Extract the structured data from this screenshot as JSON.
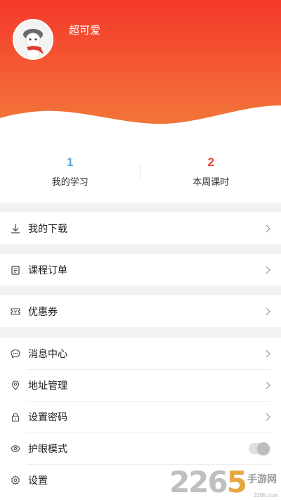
{
  "colors": {
    "accent": "#f24a2e",
    "stat_blue": "#5aa8d8",
    "stat_red": "#e84535"
  },
  "profile": {
    "username": "超可爱",
    "avatar_icon": "cartoon-avatar"
  },
  "stats": [
    {
      "value": "1",
      "label": "我的学习"
    },
    {
      "value": "2",
      "label": "本周课时"
    }
  ],
  "menu": {
    "download": "我的下载",
    "course_order": "课程订单",
    "coupon": "优惠券",
    "message_center": "消息中心",
    "address": "地址管理",
    "password": "设置密码",
    "eye_mode": "护眼模式",
    "settings": "设置"
  },
  "watermark": {
    "number": "2265",
    "highlight_index": 3,
    "text": "手游网",
    "url": "2265.com"
  }
}
